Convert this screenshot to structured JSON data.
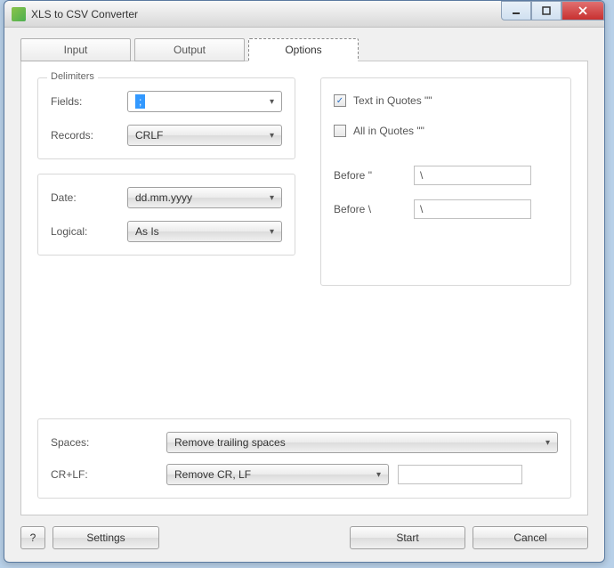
{
  "window": {
    "title": "XLS to CSV Converter"
  },
  "tabs": {
    "input": "Input",
    "output": "Output",
    "options": "Options"
  },
  "delimiters": {
    "legend": "Delimiters",
    "fields_label": "Fields:",
    "fields_value": ";",
    "records_label": "Records:",
    "records_value": "CRLF"
  },
  "format": {
    "date_label": "Date:",
    "date_value": "dd.mm.yyyy",
    "logical_label": "Logical:",
    "logical_value": "As Is"
  },
  "quotes": {
    "text_in_quotes_label": "Text in Quotes \"\"",
    "text_in_quotes_checked": true,
    "all_in_quotes_label": "All in Quotes \"\"",
    "all_in_quotes_checked": false,
    "before_quote_label": "Before \"",
    "before_quote_value": "\\",
    "before_backslash_label": "Before \\",
    "before_backslash_value": "\\"
  },
  "cleanup": {
    "spaces_label": "Spaces:",
    "spaces_value": "Remove trailing spaces",
    "crlf_label": "CR+LF:",
    "crlf_value": "Remove CR, LF",
    "crlf_extra_value": ""
  },
  "buttons": {
    "help": "?",
    "settings": "Settings",
    "start": "Start",
    "cancel": "Cancel"
  }
}
